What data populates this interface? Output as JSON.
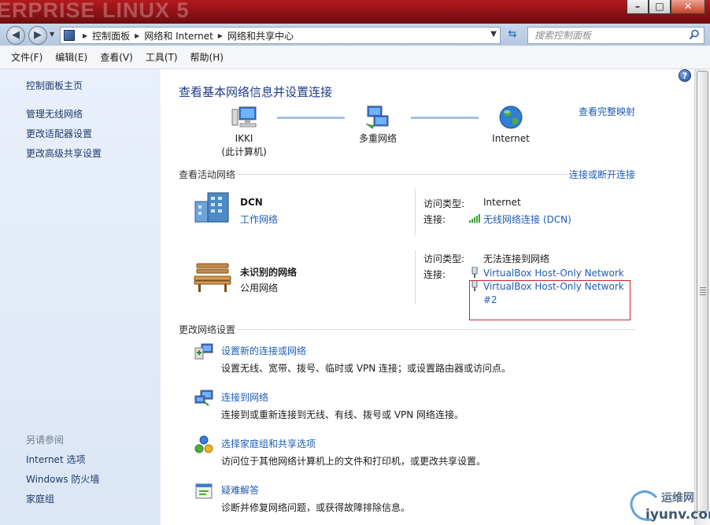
{
  "window": {
    "title_background_text": "ERPRISE LINUX 5",
    "controls": {
      "minimize": "–",
      "maximize": "□",
      "close": "✕"
    }
  },
  "address_bar": {
    "breadcrumbs": [
      "控制面板",
      "网络和 Internet",
      "网络和共享中心"
    ],
    "search_placeholder": "搜索控制面板"
  },
  "menu": [
    "文件(F)",
    "编辑(E)",
    "查看(V)",
    "工具(T)",
    "帮助(H)"
  ],
  "sidebar": {
    "links": [
      "控制面板主页",
      "管理无线网络",
      "更改适配器设置",
      "更改高级共享设置"
    ],
    "see_also_heading": "另请参阅",
    "see_also": [
      "Internet 选项",
      "Windows 防火墙",
      "家庭组"
    ]
  },
  "main": {
    "title": "查看基本网络信息并设置连接",
    "full_map_link": "查看完整映射",
    "network_map": {
      "computer_name": "IKKI",
      "computer_sub": "(此计算机)",
      "middle": "多重网络",
      "internet": "Internet"
    },
    "active_networks_heading": "查看活动网络",
    "connect_disconnect_link": "连接或断开连接",
    "networks": [
      {
        "name": "DCN",
        "type": "工作网络",
        "access_label": "访问类型:",
        "access_value": "Internet",
        "conn_label": "连接:",
        "connections": [
          "无线网络连接 (DCN)"
        ]
      },
      {
        "name": "未识别的网络",
        "type": "公用网络",
        "access_label": "访问类型:",
        "access_value": "无法连接到网络",
        "conn_label": "连接:",
        "connections": [
          "VirtualBox Host-Only Network",
          "VirtualBox Host-Only Network",
          "#2"
        ]
      }
    ],
    "change_settings_heading": "更改网络设置",
    "tasks": [
      {
        "link": "设置新的连接或网络",
        "desc": "设置无线、宽带、拨号、临时或 VPN 连接；或设置路由器或访问点。"
      },
      {
        "link": "连接到网络",
        "desc": "连接到或重新连接到无线、有线、拨号或 VPN 网络连接。"
      },
      {
        "link": "选择家庭组和共享选项",
        "desc": "访问位于其他网络计算机上的文件和打印机，或更改共享设置。"
      },
      {
        "link": "疑难解答",
        "desc": "诊断并修复网络问题，或获得故障排除信息。"
      }
    ]
  },
  "watermark": {
    "line1": "运维网",
    "line2": "iyunv.com"
  },
  "colors": {
    "link": "#1e5cb3",
    "title": "#1e3d8a",
    "sidebar": "#e9f0fb",
    "highlight": "#c62828"
  }
}
